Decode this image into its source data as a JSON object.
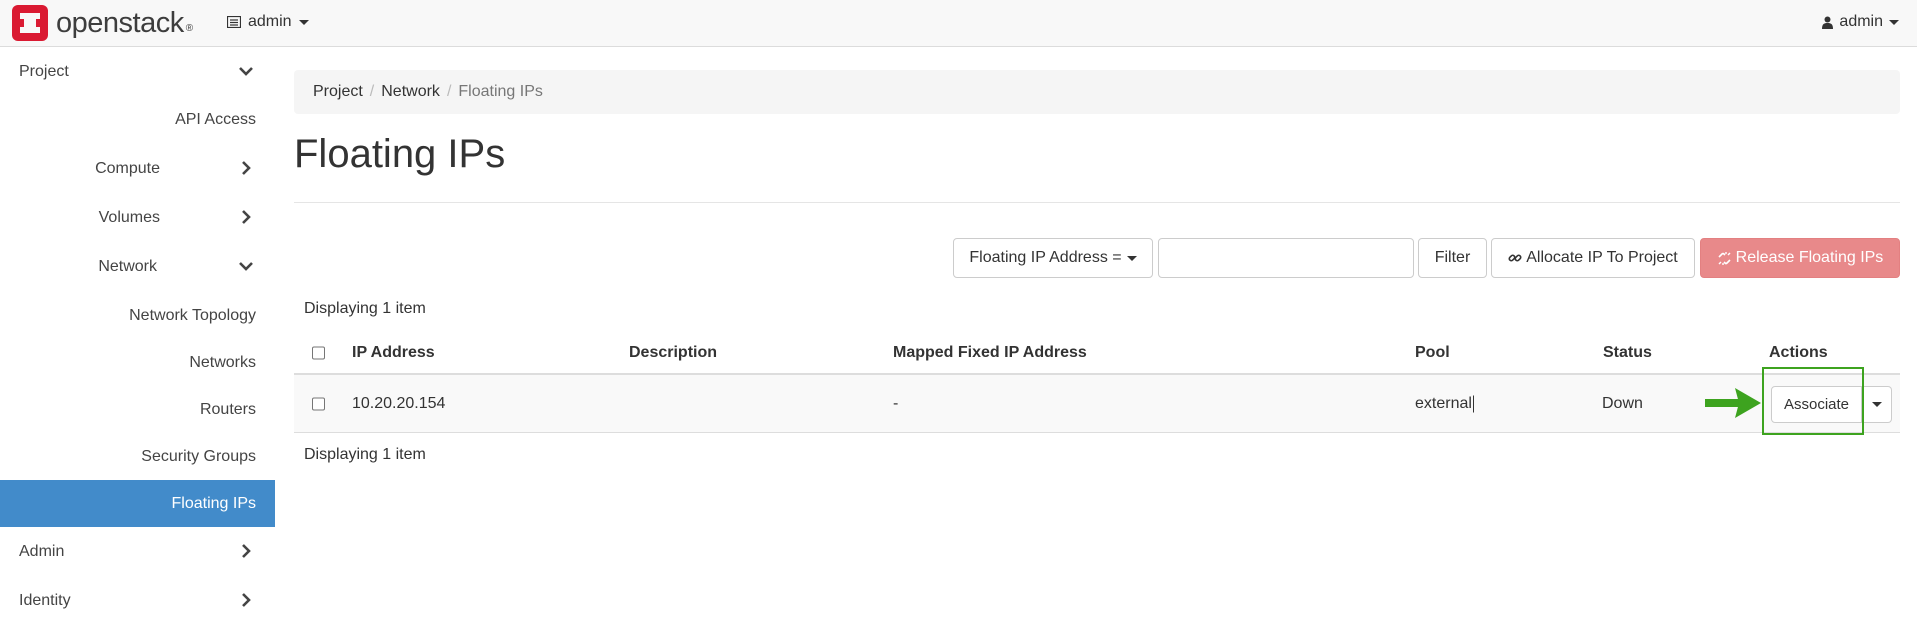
{
  "topbar": {
    "logo_text": "openstack",
    "logo_reg": "®",
    "project": "admin",
    "user": "admin"
  },
  "sidebar": {
    "items": [
      {
        "label": "Project",
        "chevron": "down"
      },
      {
        "label": "API Access",
        "chevron": "none"
      },
      {
        "label": "Compute",
        "chevron": "right"
      },
      {
        "label": "Volumes",
        "chevron": "right"
      },
      {
        "label": "Network",
        "chevron": "down"
      },
      {
        "label": "Network Topology",
        "chevron": "none"
      },
      {
        "label": "Networks",
        "chevron": "none"
      },
      {
        "label": "Routers",
        "chevron": "none"
      },
      {
        "label": "Security Groups",
        "chevron": "none"
      },
      {
        "label": "Floating IPs",
        "chevron": "none",
        "active": true
      },
      {
        "label": "Admin",
        "chevron": "right"
      },
      {
        "label": "Identity",
        "chevron": "right"
      }
    ]
  },
  "breadcrumb": [
    "Project",
    "Network",
    "Floating IPs"
  ],
  "page_title": "Floating IPs",
  "toolbar": {
    "filter_field": "Floating IP Address =",
    "filter_value": "",
    "filter_button": "Filter",
    "allocate_button": "Allocate IP To Project",
    "release_button": "Release Floating IPs"
  },
  "table": {
    "count_top": "Displaying 1 item",
    "count_bottom": "Displaying 1 item",
    "columns": [
      "IP Address",
      "Description",
      "Mapped Fixed IP Address",
      "Pool",
      "Status",
      "Actions"
    ],
    "rows": [
      {
        "ip_address": "10.20.20.154",
        "description": "",
        "mapped_fixed_ip": "-",
        "pool": "external",
        "status": "Down",
        "action": "Associate"
      }
    ]
  },
  "colors": {
    "accent": "#428bca",
    "danger": "#e8898a",
    "highlight": "#3da31f",
    "brand": "#da1a32"
  }
}
